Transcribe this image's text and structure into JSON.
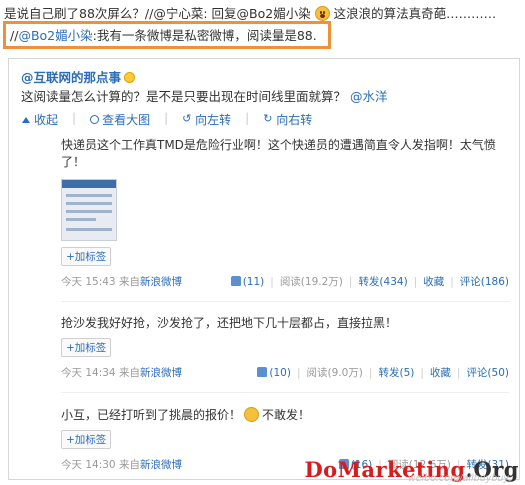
{
  "top": {
    "line1": "是说自己刷了88次屏么？//@宁心菜: 回复@Bo2媚小染",
    "line1_tail": "这浪浪的算法真奇葩…………",
    "line2_prefix": "//",
    "line2_mention": "@Bo2媚小染",
    "line2_text": ":我有一条微博是私密微博，阅读量是88."
  },
  "original": {
    "author": "@互联网的那点事",
    "question": "这阅读量怎么计算的？是不是只要出现在时间线里面就算？",
    "question_mention": "@水洋",
    "actions": {
      "collapse": "收起",
      "view_large": "查看大图",
      "rotate_left": "向左转",
      "rotate_right": "向右转"
    }
  },
  "posts": [
    {
      "text": "快递员这个工作真TMD是危险行业啊！这个快递员的遭遇简直令人发指啊！太气愤了！",
      "tag": "+加标签",
      "time": "今天 15:43",
      "source_prefix": "来自",
      "source": "新浪微博",
      "likes": "(11)",
      "read": "阅读(19.2万)",
      "repost": "转发(434)",
      "fav": "收藏",
      "comment": "评论(186)"
    },
    {
      "text": "抢沙发我好好抢，沙发抢了，还把地下几十层都占，直接拉黑！",
      "tag": "+加标签",
      "time": "今天 14:34",
      "source_prefix": "来自",
      "source": "新浪微博",
      "likes": "(10)",
      "read": "阅读(9.0万)",
      "repost": "转发(5)",
      "fav": "收藏",
      "comment": "评论(50)"
    },
    {
      "text": "小互，已经打听到了挑晨的报价！",
      "text_tail": "不敢发！",
      "tag": "+加标签",
      "time": "今天 14:30",
      "source_prefix": "来自",
      "source": "新浪微博",
      "likes": "(16)",
      "read": "阅读(12.6万)",
      "repost": "转发(31)",
      "fav": "收藏",
      "comment": "评论(45)"
    }
  ],
  "watermark": {
    "brand_red": "DoMarketing",
    "brand_dark": ".Org",
    "url": "weibo.com/allbuybuy"
  },
  "colors": {
    "link": "#2a6dbb",
    "highlight_border": "#f0903a",
    "brand_red": "#d81c1c"
  },
  "icons": [
    "surprised-emoji-icon",
    "collapse-icon",
    "zoom-icon",
    "rotate-left-icon",
    "rotate-right-icon",
    "thumbs-up-icon",
    "laughing-emoji-icon"
  ]
}
